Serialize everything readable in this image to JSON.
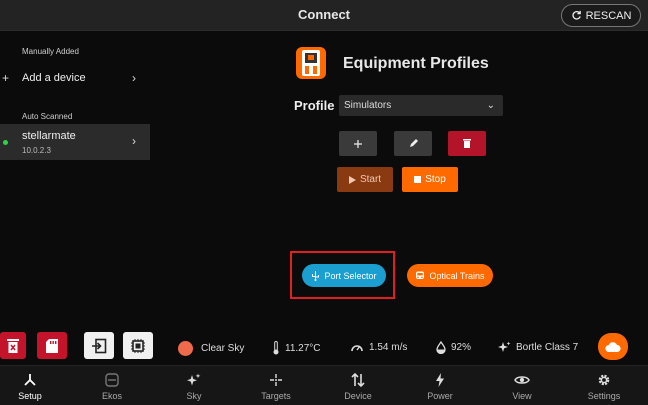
{
  "header": {
    "title": "Connect",
    "rescan_label": "RESCAN"
  },
  "sidebar": {
    "manual_label": "Manually Added",
    "add_device_label": "Add a device",
    "auto_label": "Auto Scanned",
    "device": {
      "name": "stellarmate",
      "ip": "10.0.2.3"
    }
  },
  "main": {
    "title": "Equipment Profiles",
    "profile_label": "Profile",
    "profile_value": "Simulators",
    "start_label": "Start",
    "stop_label": "Stop",
    "port_selector_label": "Port Selector",
    "optical_trains_label": "Optical Trains"
  },
  "status": {
    "sky": "Clear Sky",
    "temperature": "11.27°C",
    "wind": "1.54 m/s",
    "humidity": "92%",
    "bortle": "Bortle Class 7"
  },
  "nav": [
    {
      "label": "Setup"
    },
    {
      "label": "Ekos"
    },
    {
      "label": "Sky"
    },
    {
      "label": "Targets"
    },
    {
      "label": "Device"
    },
    {
      "label": "Power"
    },
    {
      "label": "View"
    },
    {
      "label": "Settings"
    }
  ],
  "colors": {
    "accent": "#ff6a00",
    "port_blue": "#1a9fd0",
    "delete_red": "#b3142a",
    "start_brown": "#8a3a10",
    "online_green": "#2bd44a",
    "highlight_red": "#e02020"
  }
}
